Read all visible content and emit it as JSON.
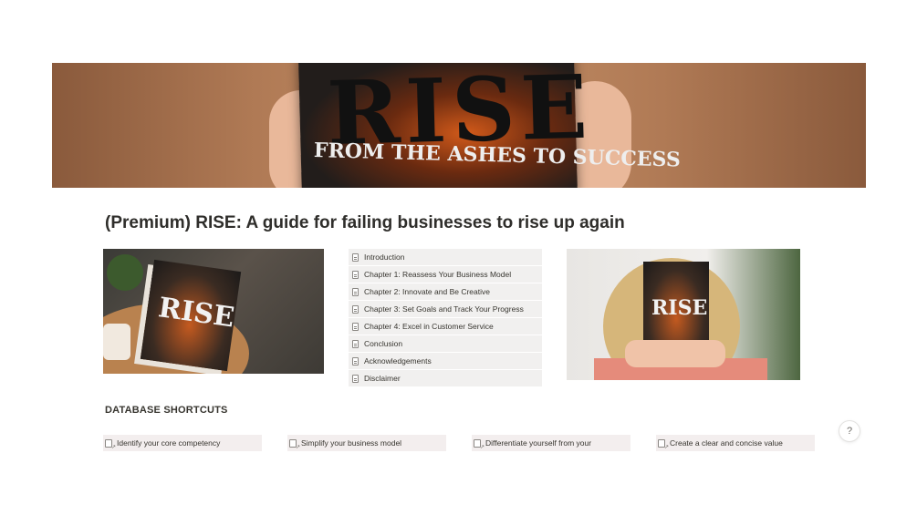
{
  "cover": {
    "book_title": "RISE",
    "book_subtitle": "FROM THE ASHES TO SUCCESS"
  },
  "page_title": "(Premium) RISE: A guide for failing businesses to rise up again",
  "left_image": {
    "book_title": "RISE"
  },
  "right_image": {
    "book_title": "RISE"
  },
  "chapters": [
    {
      "label": "Introduction"
    },
    {
      "label": "Chapter 1: Reassess Your Business Model"
    },
    {
      "label": "Chapter 2: Innovate and Be Creative"
    },
    {
      "label": "Chapter 3: Set Goals and Track Your Progress"
    },
    {
      "label": "Chapter 4: Excel in Customer Service"
    },
    {
      "label": "Conclusion"
    },
    {
      "label": "Acknowledgements"
    },
    {
      "label": "Disclaimer"
    }
  ],
  "database_shortcuts": {
    "heading": "DATABASE SHORTCUTS",
    "items": [
      {
        "label": "Identify your core competency"
      },
      {
        "label": "Simplify your business model"
      },
      {
        "label": "Differentiate yourself from your"
      },
      {
        "label": "Create a clear and concise value"
      }
    ]
  },
  "help": {
    "label": "?"
  },
  "colors": {
    "chapter_bg": "#f1f0ef",
    "shortcut_bg": "#f3eeee",
    "text": "#37352f"
  },
  "icons": [
    "doc-icon",
    "page-link-icon",
    "help-icon"
  ]
}
